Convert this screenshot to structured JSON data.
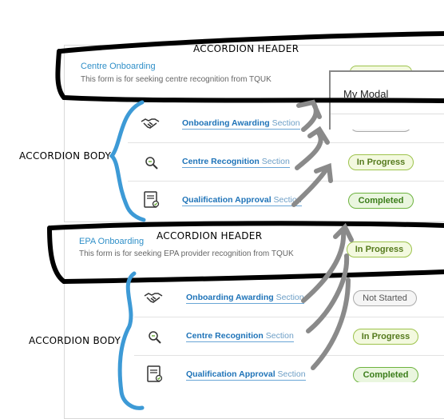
{
  "annotations": {
    "header_1": "ACCORDION HEADER",
    "header_2": "ACCORDION HEADER",
    "body_1": "ACCORDION BODY",
    "body_2": "ACCORDION BODY"
  },
  "modal": {
    "title": "My Modal"
  },
  "accordions": [
    {
      "title": "Centre Onboarding",
      "subtitle": "This form is for seeking centre recognition from TQUK",
      "rows": [
        {
          "name_bold": "Onboarding Awarding",
          "name_light": "Section",
          "status": ""
        },
        {
          "name_bold": "Centre Recognition",
          "name_light": "Section",
          "status": "In Progress"
        },
        {
          "name_bold": "Qualification Approval",
          "name_light": "Section",
          "status": "Completed"
        }
      ]
    },
    {
      "title": "EPA Onboarding",
      "subtitle": "This form is for seeking EPA provider recognition from TQUK",
      "header_status": "In Progress",
      "rows": [
        {
          "name_bold": "Onboarding Awarding",
          "name_light": "Section",
          "status": "Not Started"
        },
        {
          "name_bold": "Centre Recognition",
          "name_light": "Section",
          "status": "In Progress"
        },
        {
          "name_bold": "Qualification Approval",
          "name_light": "Section",
          "status": "Completed"
        }
      ]
    }
  ],
  "colors": {
    "link": "#1e73b8",
    "in_progress": "#9dc34c",
    "completed": "#6db33f",
    "annotation_blue": "#3d9ad6",
    "arrow_gray": "#8a8a8a"
  },
  "icons": [
    "handshake-icon",
    "magnifier-icon",
    "certificate-icon"
  ]
}
